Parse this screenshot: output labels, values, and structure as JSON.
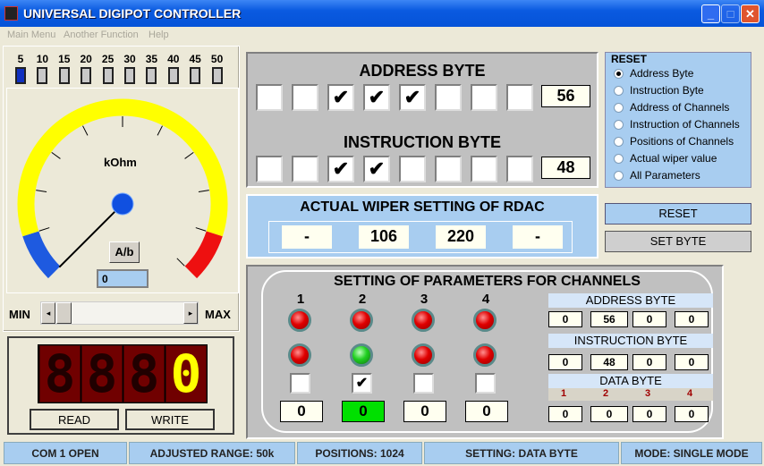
{
  "window": {
    "title": "UNIVERSAL DIGIPOT CONTROLLER",
    "minimize": "_",
    "maximize": "□",
    "close": "✕"
  },
  "menu": [
    "Main Menu",
    "Another Function",
    "Help"
  ],
  "range_switches": {
    "labels": [
      "5",
      "10",
      "15",
      "20",
      "25",
      "30",
      "35",
      "40",
      "45",
      "50"
    ],
    "selected": "5"
  },
  "gauge": {
    "unit": "kOhm",
    "button": "A/b",
    "value": "0",
    "needle_fraction": 0.0,
    "colors": {
      "arc": "#ffff00",
      "low": "#1e5ae0",
      "high": "#ee1010"
    }
  },
  "slider": {
    "min_label": "MIN",
    "max_label": "MAX",
    "position_fraction": 0.0
  },
  "display": {
    "digits": [
      "8",
      "8",
      "8",
      "0"
    ],
    "read": "READ",
    "write": "WRITE"
  },
  "address_byte": {
    "title": "ADDRESS BYTE",
    "bits": [
      false,
      false,
      true,
      true,
      true,
      false,
      false,
      false
    ],
    "value": "56"
  },
  "instruction_byte": {
    "title": "INSTRUCTION BYTE",
    "bits": [
      false,
      false,
      true,
      true,
      false,
      false,
      false,
      false
    ],
    "value": "48"
  },
  "reset_group": {
    "title": "RESET",
    "options": [
      "Address Byte",
      "Instruction Byte",
      "Address of Channels",
      "Instruction of Channels",
      "Positions of Channels",
      "Actual  wiper value",
      "All Parameters"
    ],
    "selected": "Address Byte"
  },
  "buttons": {
    "reset": "RESET",
    "set_byte": "SET BYTE"
  },
  "wiper": {
    "title": "ACTUAL WIPER SETTING OF RDAC",
    "values": [
      "-",
      "106",
      "220",
      "-"
    ]
  },
  "channels": {
    "title": "SETTING OF PARAMETERS FOR CHANNELS",
    "numbers": [
      "1",
      "2",
      "3",
      "4"
    ],
    "leds_top": [
      "red",
      "red",
      "red",
      "red"
    ],
    "leds_bottom": [
      "red",
      "green",
      "red",
      "red"
    ],
    "checked": [
      false,
      true,
      false,
      false
    ],
    "values": [
      "0",
      "0",
      "0",
      "0"
    ],
    "active_color": "#00e000",
    "address_title": "ADDRESS BYTE",
    "address": [
      "0",
      "56",
      "0",
      "0"
    ],
    "instruction_title": "INSTRUCTION BYTE",
    "instruction": [
      "0",
      "48",
      "0",
      "0"
    ],
    "data_title": "DATA BYTE",
    "data_labels": [
      "1",
      "2",
      "3",
      "4"
    ],
    "data": [
      "0",
      "0",
      "0",
      "0"
    ]
  },
  "statusbar": [
    "COM 1 OPEN",
    "ADJUSTED RANGE: 50k",
    "POSITIONS: 1024",
    "SETTING: DATA BYTE",
    "MODE: SINGLE MODE"
  ]
}
